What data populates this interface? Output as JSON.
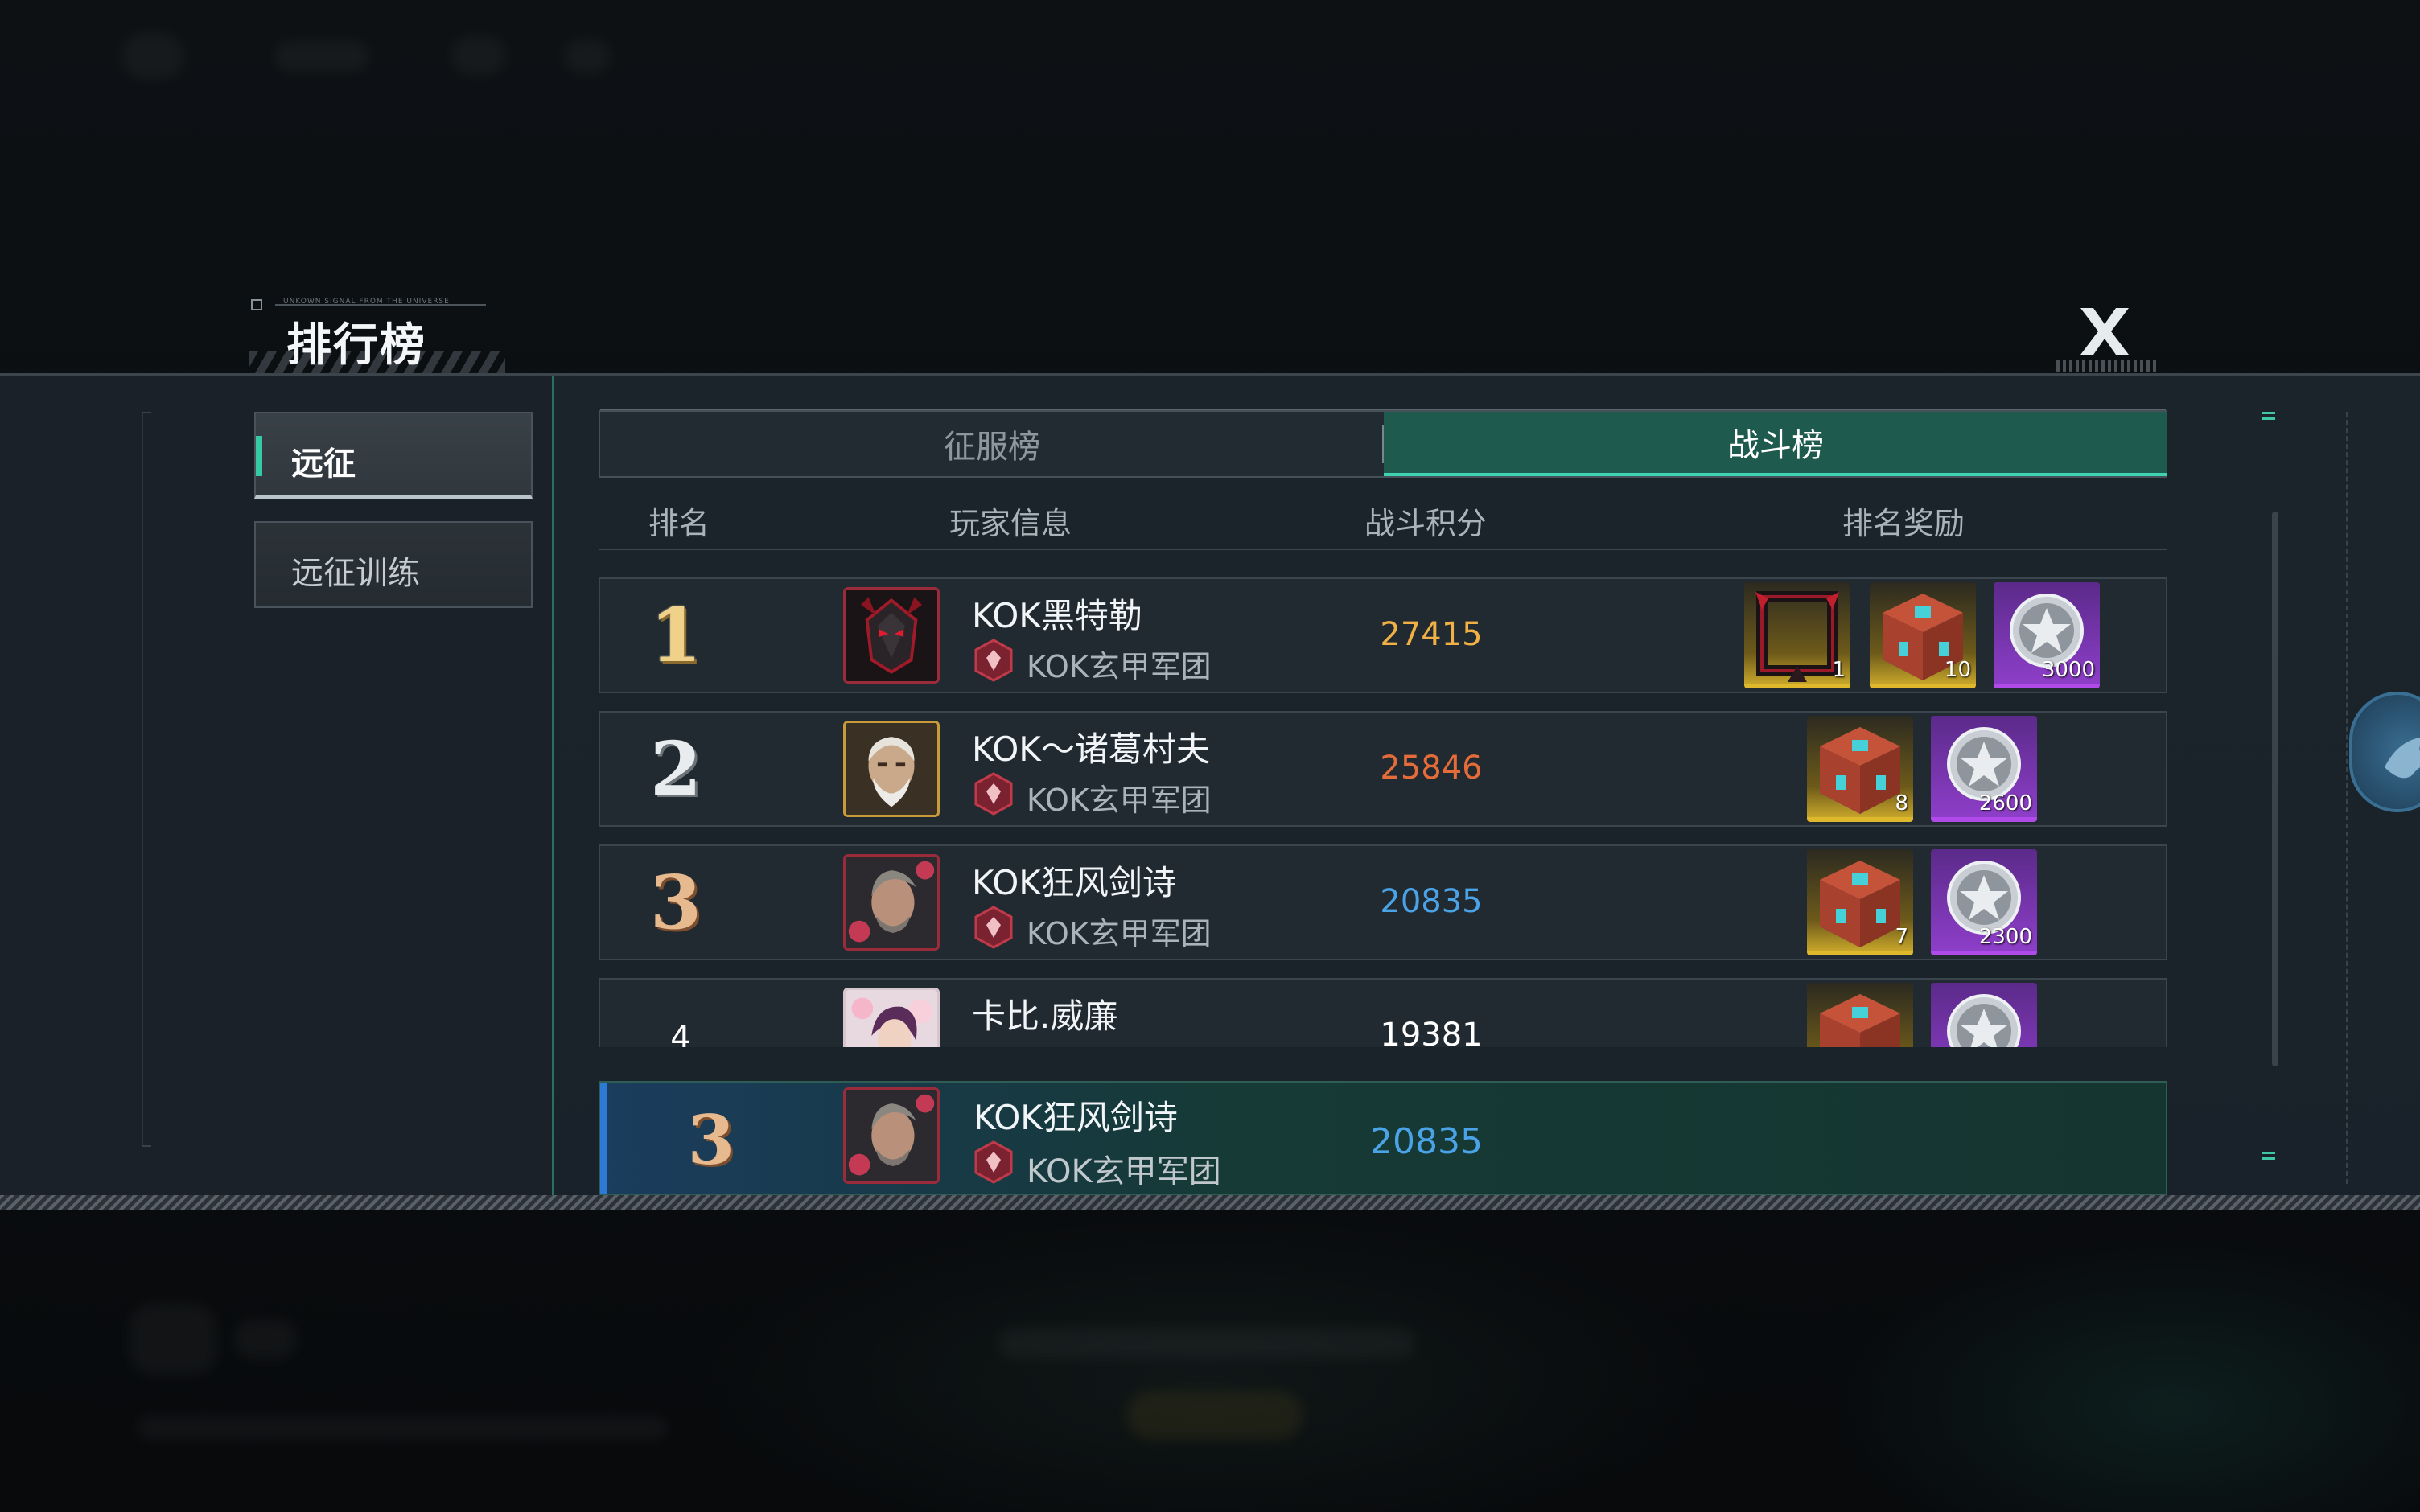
{
  "header": {
    "deco_text": "UNKOWN SIGNAL FROM THE UNIVERSE",
    "title": "排行榜",
    "close_icon": "close-x-icon"
  },
  "sidebar": {
    "items": [
      {
        "label": "远征",
        "selected": true
      },
      {
        "label": "远征训练",
        "selected": false
      }
    ]
  },
  "tabs": [
    {
      "label": "征服榜",
      "active": false
    },
    {
      "label": "战斗榜",
      "active": true
    }
  ],
  "columns": {
    "rank": "排名",
    "player": "玩家信息",
    "score": "战斗积分",
    "reward": "排名奖励"
  },
  "rows": [
    {
      "rank": "1",
      "name": "KOK黑特勒",
      "guild": "KOK玄甲军团",
      "score": "27415",
      "score_color": "#f0b046",
      "rewards": [
        {
          "icon": "frame-icon",
          "count": "1",
          "rarity": "gold"
        },
        {
          "icon": "crate-icon",
          "count": "10",
          "rarity": "gold"
        },
        {
          "icon": "star-coin-icon",
          "count": "3000",
          "rarity": "purple"
        }
      ]
    },
    {
      "rank": "2",
      "name": "KOK～诸葛村夫",
      "guild": "KOK玄甲军团",
      "score": "25846",
      "score_color": "#e46c3a",
      "rewards": [
        {
          "icon": "crate-icon",
          "count": "8",
          "rarity": "gold"
        },
        {
          "icon": "star-coin-icon",
          "count": "2600",
          "rarity": "purple"
        }
      ]
    },
    {
      "rank": "3",
      "name": "KOK狂风剑诗",
      "guild": "KOK玄甲军团",
      "score": "20835",
      "score_color": "#4aa3e6",
      "rewards": [
        {
          "icon": "crate-icon",
          "count": "7",
          "rarity": "gold"
        },
        {
          "icon": "star-coin-icon",
          "count": "2300",
          "rarity": "purple"
        }
      ]
    },
    {
      "rank": "4",
      "name": "卡比.威廉",
      "guild": "",
      "score": "19381",
      "score_color": "#ffffff",
      "rewards": [
        {
          "icon": "crate-icon",
          "count": "",
          "rarity": "gold"
        },
        {
          "icon": "star-coin-icon",
          "count": "",
          "rarity": "purple"
        }
      ]
    }
  ],
  "my_rank": {
    "rank": "3",
    "name": "KOK狂风剑诗",
    "guild": "KOK玄甲军团",
    "score": "20835"
  },
  "colors": {
    "accent_teal": "#40d3b1",
    "active_tab_bg": "#1e5a4d",
    "score_blue": "#4aa3e6"
  }
}
